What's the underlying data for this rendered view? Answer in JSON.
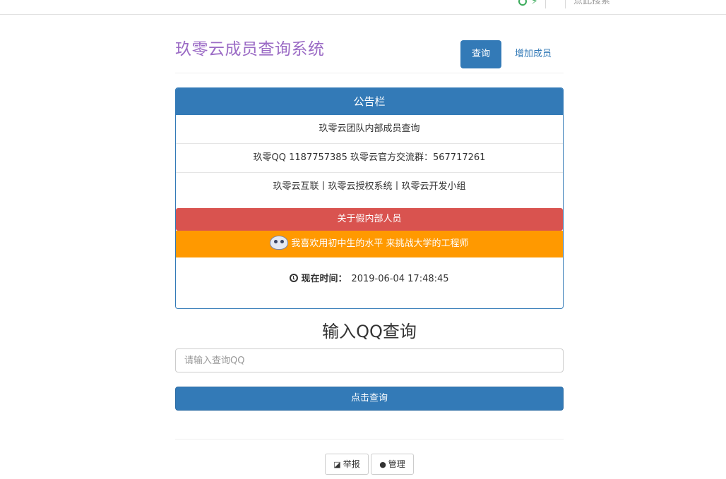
{
  "browser": {
    "search_hint": "点此搜索"
  },
  "header": {
    "title": "玖零云成员查询系统",
    "nav": {
      "query": "查询",
      "add_member": "增加成员"
    }
  },
  "notice": {
    "heading": "公告栏",
    "lines": [
      "玖零云团队内部成员查询",
      "玖零QQ 1187757385 玖零云官方交流群：567717261",
      "玖零云互联丨玖零云授权系统丨玖零云开发小组"
    ],
    "alert_red": "关于假内部人员",
    "alert_orange": "我喜欢用初中生的水平 来挑战大学的工程师",
    "time_label": "现在时间：",
    "time_value": "2019-06-04 17:48:45"
  },
  "query": {
    "heading": "输入QQ查询",
    "placeholder": "请输入查询QQ",
    "submit": "点击查询"
  },
  "footer": {
    "report": "举报",
    "manage": "管理"
  },
  "colors": {
    "primary": "#337ab7",
    "title": "#9b6bc5",
    "danger": "#d9534f",
    "warning": "#ff9900"
  }
}
